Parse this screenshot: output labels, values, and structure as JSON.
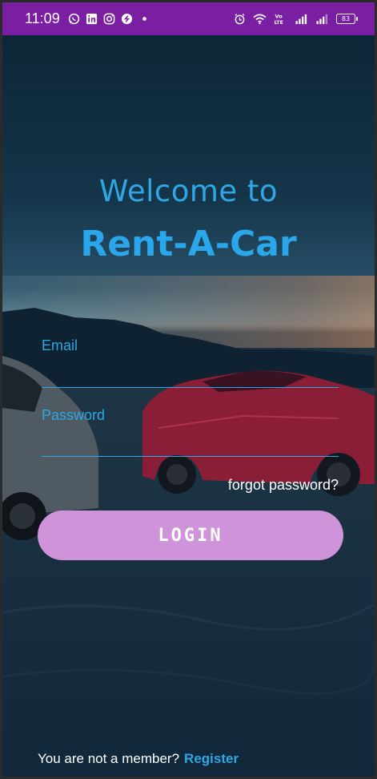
{
  "status_bar": {
    "time": "11:09",
    "battery": "83",
    "background": "#7b1fa2",
    "left_icons": [
      "whatsapp-icon",
      "linkedin-icon",
      "instagram-icon",
      "shazam-icon",
      "dot-icon"
    ],
    "right_icons": [
      "alarm-icon",
      "wifi-icon",
      "volte-icon",
      "signal-icon",
      "signal-icon",
      "battery-icon"
    ]
  },
  "header": {
    "welcome": "Welcome to",
    "brand": "Rent-A-Car"
  },
  "form": {
    "email_label": "Email",
    "email_value": "",
    "password_label": "Password",
    "password_value": "",
    "forgot_label": "forgot password?",
    "login_label": "LOGIN"
  },
  "footer": {
    "prompt": "You are not a member?",
    "register_label": "Register"
  },
  "colors": {
    "accent": "#2fa7e4",
    "button": "#ce93d8",
    "status_bar": "#7b1fa2"
  }
}
